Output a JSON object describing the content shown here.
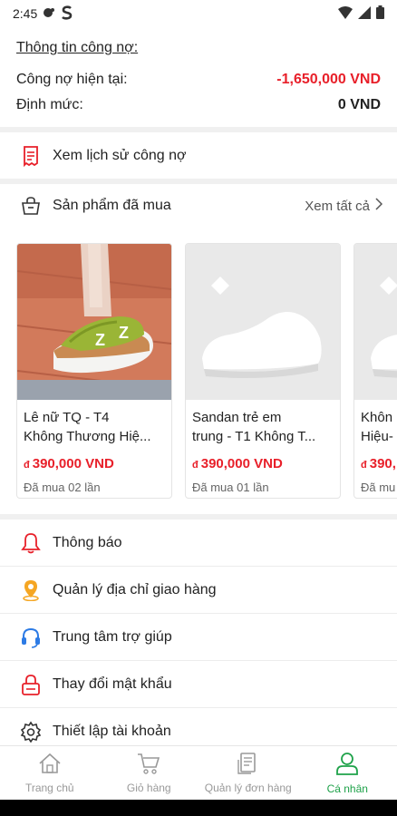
{
  "status_bar": {
    "time": "2:45"
  },
  "debt": {
    "title": "Thông tin công nợ:",
    "current_label": "Công nợ hiện tại:",
    "current_value": "-1,650,000 VND",
    "limit_label": "Định mức:",
    "limit_value": "0 VND"
  },
  "history_link": {
    "label": "Xem lịch sử công nợ"
  },
  "products": {
    "title": "Sản phẩm đã mua",
    "see_all": "Xem tất cả",
    "items": [
      {
        "name1": "Lê nữ TQ - T4",
        "name2": "Không Thương Hiệ...",
        "currency": "đ",
        "price": "390,000 VND",
        "bought": "Đã mua 02 lần"
      },
      {
        "name1": "Sandan trẻ em",
        "name2": "trung - T1 Không T...",
        "currency": "đ",
        "price": "390,000 VND",
        "bought": "Đã mua 01 lần"
      },
      {
        "name1": "Khôn",
        "name2": "Hiệu-",
        "currency": "đ",
        "price": "390,",
        "bought": "Đã mu"
      }
    ]
  },
  "menu": [
    {
      "label": "Thông báo",
      "icon": "bell-icon"
    },
    {
      "label": "Quản lý địa chỉ giao hàng",
      "icon": "location-pin-icon"
    },
    {
      "label": "Trung tâm trợ giúp",
      "icon": "headset-icon"
    },
    {
      "label": "Thay đổi mật khẩu",
      "icon": "lock-icon"
    },
    {
      "label": "Thiết lập tài khoản",
      "icon": "gear-icon"
    }
  ],
  "bottom_nav": [
    {
      "label": "Trang chủ",
      "icon": "home-icon",
      "active": false
    },
    {
      "label": "Giỏ hàng",
      "icon": "cart-icon",
      "active": false
    },
    {
      "label": "Quản lý đơn hàng",
      "icon": "orders-icon",
      "active": false
    },
    {
      "label": "Cá nhân",
      "icon": "person-icon",
      "active": true
    }
  ],
  "colors": {
    "accent_red": "#e8202a",
    "active_green": "#1fa24a",
    "pin_orange": "#f5a623",
    "help_blue": "#2d7be5"
  }
}
